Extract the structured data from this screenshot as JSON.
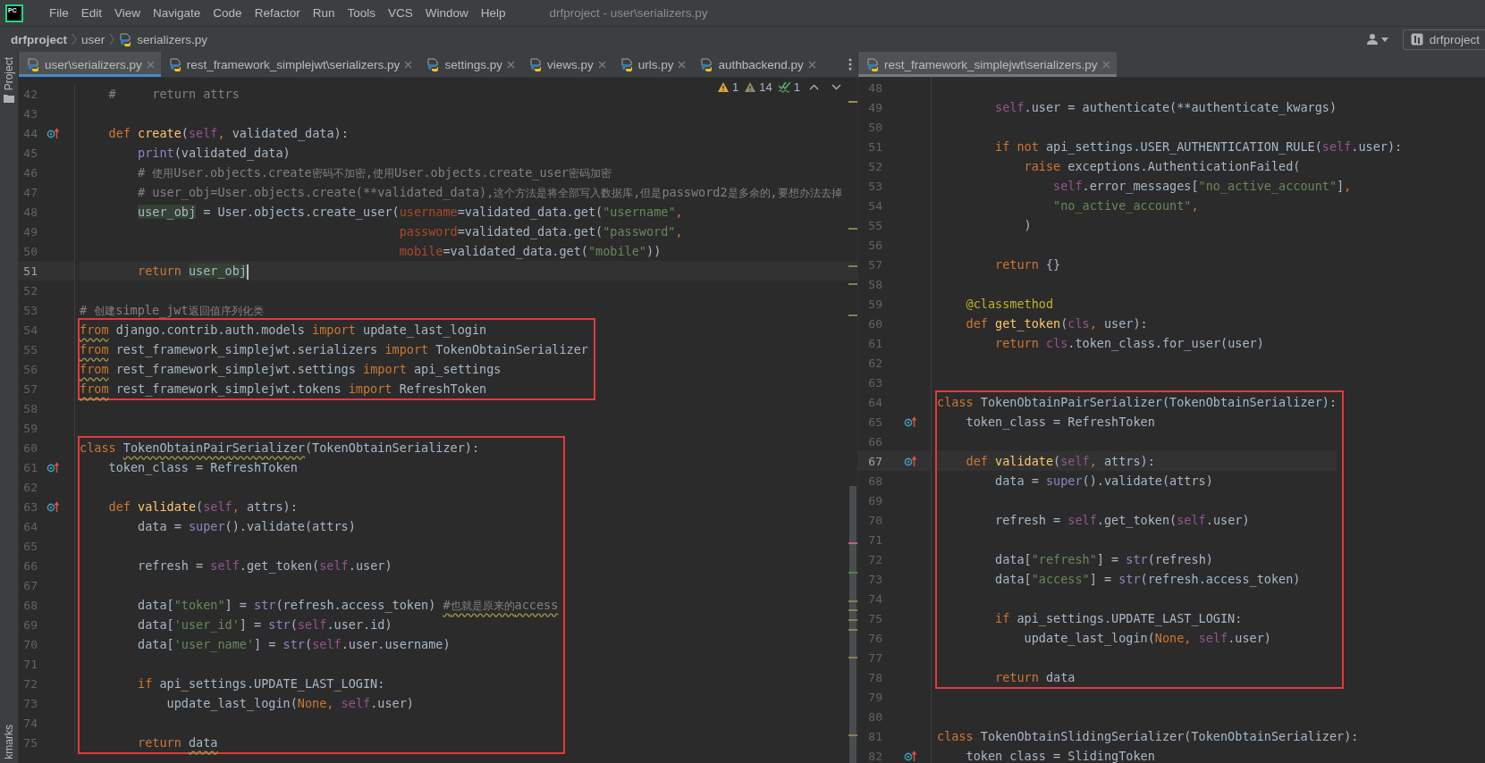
{
  "app": {
    "logo": "PC",
    "menu": [
      "File",
      "Edit",
      "View",
      "Navigate",
      "Code",
      "Refactor",
      "Run",
      "Tools",
      "VCS",
      "Window",
      "Help"
    ],
    "title": "drfproject - user\\serializers.py"
  },
  "navigation": {
    "breadcrumbs": [
      "drfproject",
      "user",
      "serializers.py"
    ],
    "run_config": "drfproject"
  },
  "sidebar": {
    "top_tab": "Project",
    "bottom_tab": "kmarks"
  },
  "editors": [
    {
      "focused": true,
      "tabs": [
        {
          "label": "user\\serializers.py",
          "selected": true
        },
        {
          "label": "rest_framework_simplejwt\\serializers.py",
          "selected": false
        },
        {
          "label": "settings.py",
          "selected": false
        },
        {
          "label": "views.py",
          "selected": false
        },
        {
          "label": "urls.py",
          "selected": false
        },
        {
          "label": "authbackend.py",
          "selected": false
        }
      ],
      "inspections": [
        {
          "kind": "warning",
          "count": "1"
        },
        {
          "kind": "weak_warning",
          "count": "14"
        },
        {
          "kind": "typo",
          "count": "1"
        }
      ],
      "blocks": [
        {
          "highlighted": false,
          "lines": [
            {
              "no": "42",
              "code": [
                {
                  "text": "    #     return attrs",
                  "kind": "comment"
                }
              ]
            },
            {
              "no": "43"
            },
            {
              "no": "44",
              "override": true,
              "code": [
                {
                  "text": "    def ",
                  "kind": "keyword"
                },
                {
                  "text": "create",
                  "kind": "function"
                },
                "(",
                {
                  "text": "self",
                  "kind": "self"
                },
                {
                  "text": ", ",
                  "kind": "keyword"
                },
                "validated_data):"
              ]
            },
            {
              "no": "45",
              "code": [
                {
                  "text": "        print",
                  "kind": "builtin"
                },
                "(validated_data)"
              ]
            },
            {
              "no": "46",
              "code": [
                {
                  "text": "        # 使用User.objects.create密码不加密,使用User.objects.create_user密码加密",
                  "kind": "comment"
                }
              ]
            },
            {
              "no": "47",
              "code": [
                {
                  "text": "        # user_obj=User.objects.create(**validated_data),这个方法是将全部写入数据库,但是password2是多余的,要想办法去掉",
                  "kind": "comment"
                }
              ]
            },
            {
              "no": "48",
              "code": [
                {
                  "text": "        user_obj",
                  "usage": true
                },
                " = User.objects.create_user(",
                {
                  "text": "username",
                  "kind": "param"
                },
                "=validated_data.get(",
                {
                  "text": "\"username\"",
                  "kind": "string"
                },
                {
                  "text": ",",
                  "kind": "keyword"
                }
              ]
            },
            {
              "no": "49",
              "code": [
                {
                  "text": "                                            password",
                  "kind": "param"
                },
                "=validated_data.get(",
                {
                  "text": "\"password\"",
                  "kind": "string"
                },
                {
                  "text": ",",
                  "kind": "keyword"
                }
              ]
            },
            {
              "no": "50",
              "code": [
                {
                  "text": "                                            mobile",
                  "kind": "param"
                },
                "=validated_data.get(",
                {
                  "text": "\"mobile\"",
                  "kind": "string"
                },
                "))"
              ]
            },
            {
              "no": "51",
              "current": true,
              "caret": true,
              "code": [
                {
                  "text": "        return ",
                  "kind": "keyword"
                },
                {
                  "text": "user_obj",
                  "usage": true
                }
              ]
            },
            {
              "no": "52"
            },
            {
              "no": "53",
              "code": [
                {
                  "text": "# 创建simple_jwt返回值序列化类",
                  "kind": "comment"
                }
              ]
            }
          ]
        },
        {
          "highlighted": true,
          "lines": [
            {
              "no": "54",
              "code": [
                {
                  "text": "from",
                  "kind": "keyword",
                  "squiggle": true
                },
                " django.contrib.auth.models ",
                {
                  "text": "import",
                  "kind": "keyword"
                },
                " update_last_login"
              ]
            },
            {
              "no": "55",
              "code": [
                {
                  "text": "from",
                  "kind": "keyword",
                  "squiggle": true
                },
                " rest_framework_simplejwt.serializers ",
                {
                  "text": "import",
                  "kind": "keyword"
                },
                " TokenObtainSerializer"
              ]
            },
            {
              "no": "56",
              "code": [
                {
                  "text": "from",
                  "kind": "keyword",
                  "squiggle": true
                },
                " rest_framework_simplejwt.settings ",
                {
                  "text": "import",
                  "kind": "keyword"
                },
                " api_settings"
              ]
            },
            {
              "no": "57",
              "code": [
                {
                  "text": "from",
                  "kind": "keyword",
                  "squiggle": true
                },
                " rest_framework_simplejwt.tokens ",
                {
                  "text": "import",
                  "kind": "keyword"
                },
                " RefreshToken"
              ]
            }
          ]
        },
        {
          "highlighted": false,
          "lines": [
            {
              "no": "58"
            },
            {
              "no": "59"
            }
          ]
        },
        {
          "highlighted": true,
          "lines": [
            {
              "no": "60",
              "code": [
                {
                  "text": "class ",
                  "kind": "keyword"
                },
                {
                  "text": "TokenObtainPairSerializer",
                  "squiggle": true
                },
                "(TokenObtainSerializer):"
              ]
            },
            {
              "no": "61",
              "override": true,
              "code": [
                "    token_class = RefreshToken"
              ]
            },
            {
              "no": "62"
            },
            {
              "no": "63",
              "override": true,
              "code": [
                {
                  "text": "    def ",
                  "kind": "keyword"
                },
                {
                  "text": "validate",
                  "kind": "function"
                },
                "(",
                {
                  "text": "self",
                  "kind": "self"
                },
                {
                  "text": ", ",
                  "kind": "keyword"
                },
                "attrs):"
              ]
            },
            {
              "no": "64",
              "code": [
                "        data = ",
                {
                  "text": "super",
                  "kind": "builtin"
                },
                "().validate(attrs)"
              ]
            },
            {
              "no": "65"
            },
            {
              "no": "66",
              "code": [
                "        refresh = ",
                {
                  "text": "self",
                  "kind": "self"
                },
                ".get_token(",
                {
                  "text": "self",
                  "kind": "self"
                },
                ".user)"
              ]
            },
            {
              "no": "67"
            },
            {
              "no": "68",
              "code": [
                "        data[",
                {
                  "text": "\"token\"",
                  "kind": "string"
                },
                "] = ",
                {
                  "text": "str",
                  "kind": "builtin"
                },
                "(refresh.access_token) ",
                {
                  "text": "#也就是原来的access",
                  "kind": "comment",
                  "squiggle": true
                }
              ]
            },
            {
              "no": "69",
              "code": [
                "        data[",
                {
                  "text": "'user_id'",
                  "kind": "string"
                },
                "] = ",
                {
                  "text": "str",
                  "kind": "builtin"
                },
                "(",
                {
                  "text": "self",
                  "kind": "self"
                },
                ".user.id)"
              ]
            },
            {
              "no": "70",
              "code": [
                "        data[",
                {
                  "text": "'user_name'",
                  "kind": "string"
                },
                "] = ",
                {
                  "text": "str",
                  "kind": "builtin"
                },
                "(",
                {
                  "text": "self",
                  "kind": "self"
                },
                ".user.username)"
              ]
            },
            {
              "no": "71"
            },
            {
              "no": "72",
              "code": [
                {
                  "text": "        if ",
                  "kind": "keyword"
                },
                "api_settings.UPDATE_LAST_LOGIN:"
              ]
            },
            {
              "no": "73",
              "code": [
                "            update_last_login(",
                {
                  "text": "None, ",
                  "kind": "keyword"
                },
                {
                  "text": "self",
                  "kind": "self"
                },
                ".user)"
              ]
            },
            {
              "no": "74"
            },
            {
              "no": "75",
              "code": [
                {
                  "text": "        return ",
                  "kind": "keyword"
                },
                {
                  "text": "data",
                  "squiggle": true
                }
              ]
            }
          ]
        }
      ]
    },
    {
      "focused": false,
      "tabs": [
        {
          "label": "rest_framework_simplejwt\\serializers.py",
          "selected": true
        }
      ],
      "blocks": [
        {
          "highlighted": false,
          "lines": [
            {
              "no": "48"
            },
            {
              "no": "49",
              "code": [
                {
                  "text": "        self",
                  "kind": "self"
                },
                ".user = authenticate(**authenticate_kwargs)"
              ]
            },
            {
              "no": "50"
            },
            {
              "no": "51",
              "code": [
                {
                  "text": "        if not ",
                  "kind": "keyword"
                },
                "api_settings.USER_AUTHENTICATION_RULE(",
                {
                  "text": "self",
                  "kind": "self"
                },
                ".user):"
              ]
            },
            {
              "no": "52",
              "code": [
                {
                  "text": "            raise ",
                  "kind": "keyword"
                },
                "exceptions.AuthenticationFailed("
              ]
            },
            {
              "no": "53",
              "code": [
                {
                  "text": "                self",
                  "kind": "self"
                },
                ".error_messages[",
                {
                  "text": "\"no_active_account\"",
                  "kind": "string"
                },
                "]",
                {
                  "text": ",",
                  "kind": "keyword"
                }
              ]
            },
            {
              "no": "54",
              "code": [
                {
                  "text": "                \"no_active_account\"",
                  "kind": "string"
                },
                {
                  "text": ",",
                  "kind": "keyword"
                }
              ]
            },
            {
              "no": "55",
              "code": [
                "            )"
              ]
            },
            {
              "no": "56"
            },
            {
              "no": "57",
              "code": [
                {
                  "text": "        return ",
                  "kind": "keyword"
                },
                "{}"
              ]
            },
            {
              "no": "58"
            },
            {
              "no": "59",
              "code": [
                {
                  "text": "    @classmethod",
                  "kind": "decorator"
                }
              ]
            },
            {
              "no": "60",
              "code": [
                {
                  "text": "    def ",
                  "kind": "keyword"
                },
                {
                  "text": "get_token",
                  "kind": "function"
                },
                "(",
                {
                  "text": "cls",
                  "kind": "self"
                },
                {
                  "text": ", ",
                  "kind": "keyword"
                },
                "user):"
              ]
            },
            {
              "no": "61",
              "code": [
                {
                  "text": "        return ",
                  "kind": "keyword"
                },
                {
                  "text": "cls",
                  "kind": "self"
                },
                ".token_class.for_user(user)"
              ]
            },
            {
              "no": "62"
            },
            {
              "no": "63"
            }
          ]
        },
        {
          "highlighted": true,
          "lines": [
            {
              "no": "64",
              "code": [
                {
                  "text": "class ",
                  "kind": "keyword"
                },
                "TokenObtainPairSerializer(TokenObtainSerializer):"
              ]
            },
            {
              "no": "65",
              "override": true,
              "code": [
                "    token_class = RefreshToken"
              ]
            },
            {
              "no": "66"
            },
            {
              "no": "67",
              "current": true,
              "override": true,
              "code": [
                {
                  "text": "    def ",
                  "kind": "keyword"
                },
                {
                  "text": "validate",
                  "kind": "function"
                },
                "(",
                {
                  "text": "self",
                  "kind": "self"
                },
                {
                  "text": ", ",
                  "kind": "keyword"
                },
                "attrs):"
              ]
            },
            {
              "no": "68",
              "code": [
                "        data = ",
                {
                  "text": "super",
                  "kind": "builtin"
                },
                "().validate(attrs)"
              ]
            },
            {
              "no": "69"
            },
            {
              "no": "70",
              "code": [
                "        refresh = ",
                {
                  "text": "self",
                  "kind": "self"
                },
                ".get_token(",
                {
                  "text": "self",
                  "kind": "self"
                },
                ".user)"
              ]
            },
            {
              "no": "71"
            },
            {
              "no": "72",
              "code": [
                "        data[",
                {
                  "text": "\"refresh\"",
                  "kind": "string"
                },
                "] = ",
                {
                  "text": "str",
                  "kind": "builtin"
                },
                "(refresh)"
              ]
            },
            {
              "no": "73",
              "code": [
                "        data[",
                {
                  "text": "\"access\"",
                  "kind": "string"
                },
                "] = ",
                {
                  "text": "str",
                  "kind": "builtin"
                },
                "(refresh.access_token)"
              ]
            },
            {
              "no": "74"
            },
            {
              "no": "75",
              "code": [
                {
                  "text": "        if ",
                  "kind": "keyword"
                },
                "api_settings.UPDATE_LAST_LOGIN:"
              ]
            },
            {
              "no": "76",
              "code": [
                "            update_last_login(",
                {
                  "text": "None, ",
                  "kind": "keyword"
                },
                {
                  "text": "self",
                  "kind": "self"
                },
                ".user)"
              ]
            },
            {
              "no": "77"
            },
            {
              "no": "78",
              "code": [
                {
                  "text": "        return ",
                  "kind": "keyword"
                },
                "data"
              ]
            }
          ]
        },
        {
          "highlighted": false,
          "lines": [
            {
              "no": "79"
            },
            {
              "no": "80"
            },
            {
              "no": "81",
              "code": [
                {
                  "text": "class ",
                  "kind": "keyword"
                },
                "TokenObtainSlidingSerializer(TokenObtainSerializer):"
              ]
            },
            {
              "no": "82",
              "override": true,
              "code": [
                "    token_class = SlidingToken"
              ]
            }
          ]
        }
      ]
    }
  ]
}
